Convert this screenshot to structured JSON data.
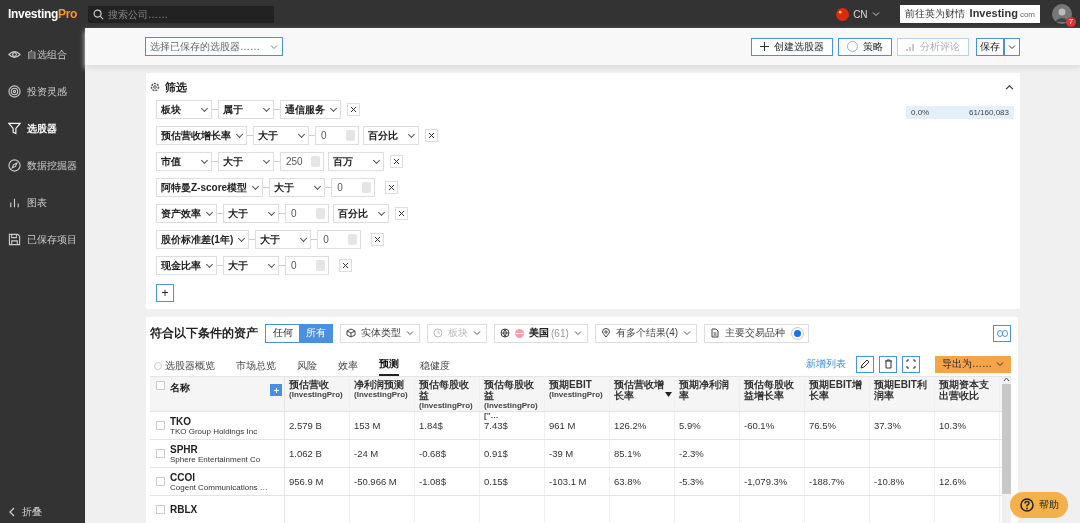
{
  "brand": {
    "main": "Investing",
    "accent": "Pro"
  },
  "search": {
    "placeholder": "搜索公司……"
  },
  "region": {
    "code": "CN"
  },
  "site_link": {
    "label": "前往英为财情",
    "logo": "Investing",
    "suffix": "com"
  },
  "avatar": {
    "badge": "7"
  },
  "sidebar": {
    "items": [
      {
        "label": "自选组合",
        "selected": false
      },
      {
        "label": "投资灵感",
        "selected": false
      },
      {
        "label": "选股器",
        "selected": true
      },
      {
        "label": "数据挖掘器",
        "selected": false
      },
      {
        "label": "图表",
        "selected": false
      },
      {
        "label": "已保存项目",
        "selected": false
      }
    ],
    "collapse": "折叠"
  },
  "toolbar": {
    "saved_select": "选择已保存的选股器……",
    "buttons": [
      {
        "label": "创建选股器",
        "kind": "create",
        "disabled": false
      },
      {
        "label": "策略",
        "kind": "strategy",
        "disabled": false
      },
      {
        "label": "分析评论",
        "kind": "analysis",
        "disabled": true
      }
    ],
    "save": "保存"
  },
  "filters": {
    "title": "筛选",
    "progress": {
      "level": 0,
      "percent": "0.0%",
      "count": "61/160,083"
    },
    "rows": [
      {
        "field": "板块",
        "op": "属于",
        "value": "通信服务"
      },
      {
        "field": "预估营收增长率",
        "op": "大于",
        "number": "0",
        "unit": "百分比"
      },
      {
        "field": "市值",
        "op": "大于",
        "number": "250",
        "unit": "百万"
      },
      {
        "field": "阿特曼Z-score模型",
        "op": "大于",
        "number": "0"
      },
      {
        "field": "资产效率",
        "op": "大于",
        "number": "0",
        "unit": "百分比"
      },
      {
        "field": "股价标准差(1年)",
        "op": "大于",
        "number": "0"
      },
      {
        "field": "现金比率",
        "op": "大于",
        "number": "0"
      }
    ],
    "add": "+"
  },
  "results": {
    "title": "符合以下条件的资产",
    "match": [
      {
        "label": "任何",
        "selected": false
      },
      {
        "label": "所有",
        "selected": true
      }
    ],
    "chips": [
      {
        "label": "实体类型",
        "kind": "dropdown",
        "disabled": false
      },
      {
        "label": "板块",
        "kind": "dropdown",
        "disabled": true
      },
      {
        "label": "美国",
        "count": "(61)",
        "kind": "dropdown",
        "disabled": false
      },
      {
        "label": "有多个结果(4)",
        "kind": "dropdown",
        "disabled": false
      },
      {
        "label": "主要交易品种",
        "kind": "toggle",
        "disabled": false,
        "on": true
      }
    ],
    "tabs": [
      {
        "label": "选股器概览",
        "selected": false
      },
      {
        "label": "市场总览",
        "selected": false
      },
      {
        "label": "风险",
        "selected": false
      },
      {
        "label": "效率",
        "selected": false
      },
      {
        "label": "预测",
        "selected": true
      },
      {
        "label": "稳健度",
        "selected": false
      }
    ],
    "add_list": "新增列表",
    "export": "导出为……",
    "table": {
      "name_column": {
        "label": "名称",
        "checked": false
      },
      "columns": [
        {
          "title": "预估营收",
          "sub": "(InvestingPro)",
          "sorted": false
        },
        {
          "title": "净利润预测",
          "sub": "(InvestingPro)",
          "sorted": false
        },
        {
          "title": "预估每股收益",
          "sub": "(InvestingPro)",
          "sorted": false
        },
        {
          "title": "预估每股收益",
          "sub": "(InvestingPro) [\"…",
          "sorted": false
        },
        {
          "title": "预期EBIT",
          "sub": "(InvestingPro)",
          "sorted": false
        },
        {
          "title": "预估营收增长率",
          "sorted": true
        },
        {
          "title": "预期净利润率",
          "sorted": false
        },
        {
          "title": "预估每股收益增长率",
          "sorted": false
        },
        {
          "title": "预期EBIT增长率",
          "sorted": false
        },
        {
          "title": "预期EBIT利润率",
          "sorted": false
        },
        {
          "title": "预期资本支出营收比",
          "sorted": false
        }
      ],
      "rows": [
        {
          "ticker": "TKO",
          "company": "TKO Group Holdings Inc",
          "checked": false,
          "cells": [
            "2.579 B",
            "153 M",
            "1.84$",
            "7.43$",
            "961 M",
            "126.2%",
            "5.9%",
            "-60.1%",
            "76.5%",
            "37.3%",
            "10.3%"
          ]
        },
        {
          "ticker": "SPHR",
          "company": "Sphere Entertainment Co",
          "checked": false,
          "cells": [
            "1.062 B",
            "-24 M",
            "-0.68$",
            "0.91$",
            "-39 M",
            "85.1%",
            "-2.3%"
          ]
        },
        {
          "ticker": "CCOI",
          "company": "Cogent Communications …",
          "checked": false,
          "cells": [
            "956.9 M",
            "-50.966 M",
            "-1.08$",
            "0.15$",
            "-103.1 M",
            "63.8%",
            "-5.3%",
            "-1,079.3%",
            "-188.7%",
            "-10.8%",
            "12.6%"
          ]
        },
        {
          "ticker": "RBLX",
          "checked": false
        }
      ]
    }
  },
  "help": "帮助"
}
